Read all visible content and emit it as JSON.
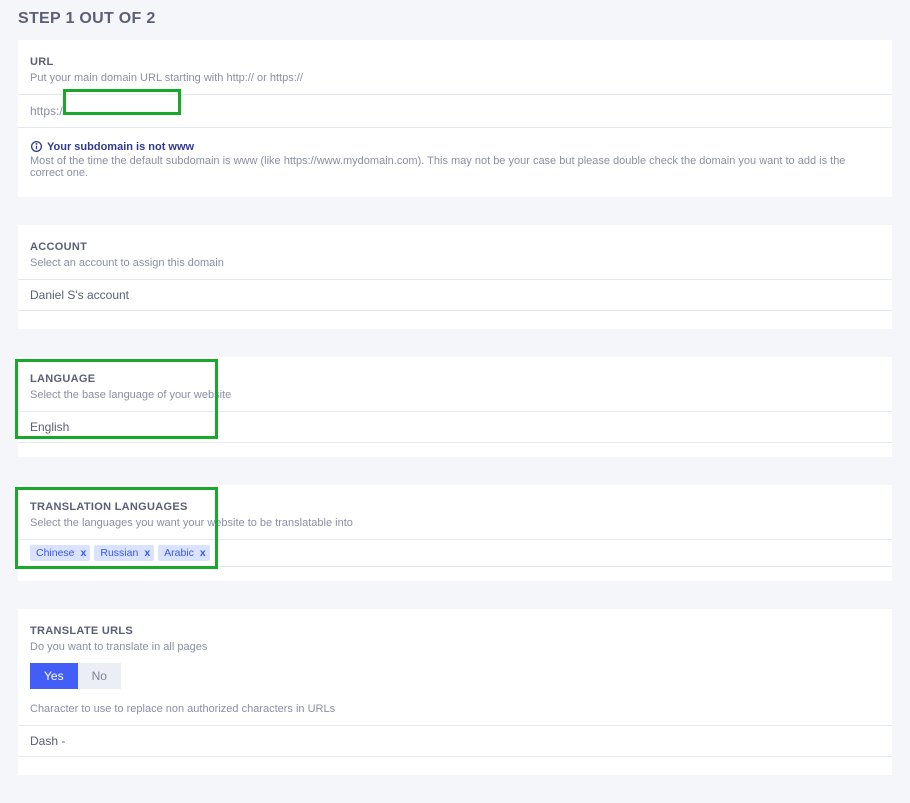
{
  "step": {
    "title": "STEP 1 OUT OF 2"
  },
  "url": {
    "label": "URL",
    "desc": "Put your main domain URL starting with http:// or https://",
    "prefix": "https://",
    "value": "",
    "info_bold": "Your subdomain is not www",
    "info_text": "Most of the time the default subdomain is www (like https://www.mydomain.com). This may not be your case but please double check the domain you want to add is the correct one."
  },
  "account": {
    "label": "ACCOUNT",
    "desc": "Select an account to assign this domain",
    "value": "Daniel S's account"
  },
  "language": {
    "label": "LANGUAGE",
    "desc": "Select the base language of your website",
    "value": "English"
  },
  "translation": {
    "label": "TRANSLATION LANGUAGES",
    "desc": "Select the languages you want your website to be translatable into",
    "chips": [
      "Chinese",
      "Russian",
      "Arabic"
    ]
  },
  "translate_urls": {
    "label": "TRANSLATE URLS",
    "desc": "Do you want to translate in all pages",
    "yes": "Yes",
    "no": "No",
    "char_desc": "Character to use to replace non authorized characters in URLs",
    "char_value": "Dash -"
  }
}
